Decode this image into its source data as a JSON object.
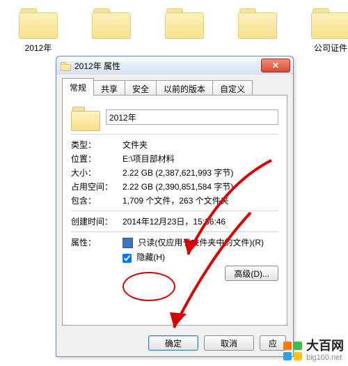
{
  "desktop": {
    "folders": [
      {
        "label": "2012年"
      },
      {
        "label": ""
      },
      {
        "label": ""
      },
      {
        "label": ""
      },
      {
        "label": "公司证件"
      }
    ]
  },
  "dialog": {
    "title": "2012年 属性",
    "close_glyph": "✕",
    "tabs": [
      "常规",
      "共享",
      "安全",
      "以前的版本",
      "自定义"
    ],
    "active_tab": 0,
    "name_value": "2012年",
    "rows": {
      "type_label": "类型：",
      "type_value": "文件夹",
      "location_label": "位置：",
      "location_value": "E:\\项目部材料",
      "size_label": "大小：",
      "size_value": "2.22 GB (2,387,621,993 字节)",
      "sizeondisk_label": "占用空间：",
      "sizeondisk_value": "2.22 GB (2,390,851,584 字节)",
      "contains_label": "包含：",
      "contains_value": "1,709 个文件，263 个文件夹",
      "created_label": "创建时间：",
      "created_value": "2014年12月23日，15:36:46",
      "attrs_label": "属性：",
      "readonly_label": "只读(仅应用于文件夹中的文件)(R)",
      "hidden_label": "隐藏(H)",
      "advanced_label": "高级(D)..."
    },
    "buttons": {
      "ok": "确定",
      "cancel": "取消",
      "apply": "应"
    }
  },
  "watermark": {
    "line1": "大百网",
    "line2": "big100.net",
    "colors": [
      "#ff7a00",
      "#3bbf4a",
      "#2aa3e8",
      "#ffc314"
    ]
  },
  "annotation": {
    "color": "#d80000"
  }
}
